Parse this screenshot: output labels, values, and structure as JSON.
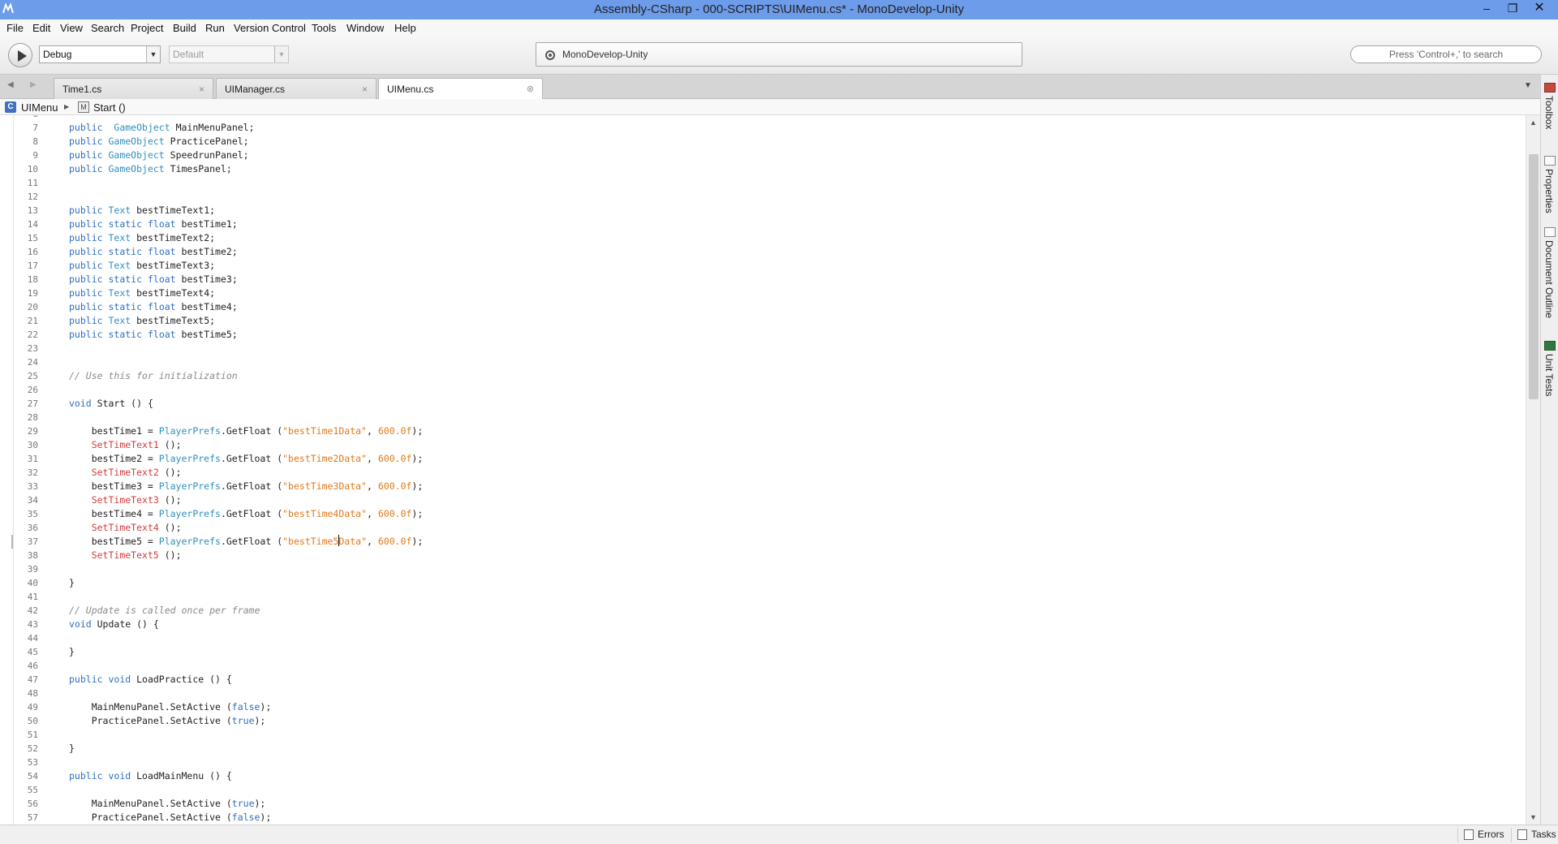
{
  "window": {
    "title": "Assembly-CSharp - 000-SCRIPTS\\UIMenu.cs* - MonoDevelop-Unity",
    "controls": {
      "minimize": "–",
      "maximize": "❐",
      "close": "✕"
    }
  },
  "menubar": {
    "items": [
      "File",
      "Edit",
      "View",
      "Search",
      "Project",
      "Build",
      "Run",
      "Version Control",
      "Tools",
      "Window",
      "Help"
    ]
  },
  "toolbar": {
    "configuration": "Debug",
    "target": "Default",
    "status_text": "MonoDevelop-Unity",
    "search_placeholder": "Press 'Control+,' to search"
  },
  "tabs": [
    {
      "label": "Time1.cs",
      "close": "×",
      "active": false
    },
    {
      "label": "UIManager.cs",
      "close": "×",
      "active": false
    },
    {
      "label": "UIMenu.cs",
      "close": "⊗",
      "active": true
    }
  ],
  "breadcrumb": {
    "class_icon": "C",
    "class_name": "UIMenu",
    "method_name": "Start ()"
  },
  "side_pads": [
    "Toolbox",
    "Properties",
    "Document Outline",
    "Unit Tests"
  ],
  "statusbar": {
    "errors_label": "Errors",
    "tasks_label": "Tasks"
  },
  "editor": {
    "current_line": 37,
    "lines": [
      {
        "n": "6",
        "tokens": []
      },
      {
        "n": "7",
        "tokens": [
          [
            "kw",
            "public"
          ],
          [
            "",
            "  "
          ],
          [
            "ty",
            "GameObject"
          ],
          [
            "",
            " MainMenuPanel;"
          ]
        ]
      },
      {
        "n": "8",
        "tokens": [
          [
            "kw",
            "public"
          ],
          [
            "",
            " "
          ],
          [
            "ty",
            "GameObject"
          ],
          [
            "",
            " PracticePanel;"
          ]
        ]
      },
      {
        "n": "9",
        "tokens": [
          [
            "kw",
            "public"
          ],
          [
            "",
            " "
          ],
          [
            "ty",
            "GameObject"
          ],
          [
            "",
            " SpeedrunPanel;"
          ]
        ]
      },
      {
        "n": "10",
        "tokens": [
          [
            "kw",
            "public"
          ],
          [
            "",
            " "
          ],
          [
            "ty",
            "GameObject"
          ],
          [
            "",
            " TimesPanel;"
          ]
        ]
      },
      {
        "n": "11",
        "tokens": []
      },
      {
        "n": "12",
        "tokens": []
      },
      {
        "n": "13",
        "tokens": [
          [
            "kw",
            "public"
          ],
          [
            "",
            " "
          ],
          [
            "ty",
            "Text"
          ],
          [
            "",
            " bestTimeText1;"
          ]
        ]
      },
      {
        "n": "14",
        "tokens": [
          [
            "kw",
            "public"
          ],
          [
            "",
            " "
          ],
          [
            "kw",
            "static"
          ],
          [
            "",
            " "
          ],
          [
            "kw",
            "float"
          ],
          [
            "",
            " bestTime1;"
          ]
        ]
      },
      {
        "n": "15",
        "tokens": [
          [
            "kw",
            "public"
          ],
          [
            "",
            " "
          ],
          [
            "ty",
            "Text"
          ],
          [
            "",
            " bestTimeText2;"
          ]
        ]
      },
      {
        "n": "16",
        "tokens": [
          [
            "kw",
            "public"
          ],
          [
            "",
            " "
          ],
          [
            "kw",
            "static"
          ],
          [
            "",
            " "
          ],
          [
            "kw",
            "float"
          ],
          [
            "",
            " bestTime2;"
          ]
        ]
      },
      {
        "n": "17",
        "tokens": [
          [
            "kw",
            "public"
          ],
          [
            "",
            " "
          ],
          [
            "ty",
            "Text"
          ],
          [
            "",
            " bestTimeText3;"
          ]
        ]
      },
      {
        "n": "18",
        "tokens": [
          [
            "kw",
            "public"
          ],
          [
            "",
            " "
          ],
          [
            "kw",
            "static"
          ],
          [
            "",
            " "
          ],
          [
            "kw",
            "float"
          ],
          [
            "",
            " bestTime3;"
          ]
        ]
      },
      {
        "n": "19",
        "tokens": [
          [
            "kw",
            "public"
          ],
          [
            "",
            " "
          ],
          [
            "ty",
            "Text"
          ],
          [
            "",
            " bestTimeText4;"
          ]
        ]
      },
      {
        "n": "20",
        "tokens": [
          [
            "kw",
            "public"
          ],
          [
            "",
            " "
          ],
          [
            "kw",
            "static"
          ],
          [
            "",
            " "
          ],
          [
            "kw",
            "float"
          ],
          [
            "",
            " bestTime4;"
          ]
        ]
      },
      {
        "n": "21",
        "tokens": [
          [
            "kw",
            "public"
          ],
          [
            "",
            " "
          ],
          [
            "ty",
            "Text"
          ],
          [
            "",
            " bestTimeText5;"
          ]
        ]
      },
      {
        "n": "22",
        "tokens": [
          [
            "kw",
            "public"
          ],
          [
            "",
            " "
          ],
          [
            "kw",
            "static"
          ],
          [
            "",
            " "
          ],
          [
            "kw",
            "float"
          ],
          [
            "",
            " bestTime5;"
          ]
        ]
      },
      {
        "n": "23",
        "tokens": []
      },
      {
        "n": "24",
        "tokens": []
      },
      {
        "n": "25",
        "tokens": [
          [
            "cm",
            "// Use this for initialization"
          ]
        ]
      },
      {
        "n": "26",
        "tokens": []
      },
      {
        "n": "27",
        "tokens": [
          [
            "kw",
            "void"
          ],
          [
            "",
            " Start () {"
          ]
        ]
      },
      {
        "n": "28",
        "tokens": []
      },
      {
        "n": "29",
        "tokens": [
          [
            "",
            "    bestTime1 = "
          ],
          [
            "ty",
            "PlayerPrefs"
          ],
          [
            "",
            ".GetFloat ("
          ],
          [
            "st",
            "\"bestTime1Data\""
          ],
          [
            "",
            ", "
          ],
          [
            "nu",
            "600.0f"
          ],
          [
            "",
            ");"
          ]
        ]
      },
      {
        "n": "30",
        "tokens": [
          [
            "",
            "    "
          ],
          [
            "mt",
            "SetTimeText1"
          ],
          [
            "",
            " ();"
          ]
        ]
      },
      {
        "n": "31",
        "tokens": [
          [
            "",
            "    bestTime2 = "
          ],
          [
            "ty",
            "PlayerPrefs"
          ],
          [
            "",
            ".GetFloat ("
          ],
          [
            "st",
            "\"bestTime2Data\""
          ],
          [
            "",
            ", "
          ],
          [
            "nu",
            "600.0f"
          ],
          [
            "",
            ");"
          ]
        ]
      },
      {
        "n": "32",
        "tokens": [
          [
            "",
            "    "
          ],
          [
            "mt",
            "SetTimeText2"
          ],
          [
            "",
            " ();"
          ]
        ]
      },
      {
        "n": "33",
        "tokens": [
          [
            "",
            "    bestTime3 = "
          ],
          [
            "ty",
            "PlayerPrefs"
          ],
          [
            "",
            ".GetFloat ("
          ],
          [
            "st",
            "\"bestTime3Data\""
          ],
          [
            "",
            ", "
          ],
          [
            "nu",
            "600.0f"
          ],
          [
            "",
            ");"
          ]
        ]
      },
      {
        "n": "34",
        "tokens": [
          [
            "",
            "    "
          ],
          [
            "mt",
            "SetTimeText3"
          ],
          [
            "",
            " ();"
          ]
        ]
      },
      {
        "n": "35",
        "tokens": [
          [
            "",
            "    bestTime4 = "
          ],
          [
            "ty",
            "PlayerPrefs"
          ],
          [
            "",
            ".GetFloat ("
          ],
          [
            "st",
            "\"bestTime4Data\""
          ],
          [
            "",
            ", "
          ],
          [
            "nu",
            "600.0f"
          ],
          [
            "",
            ");"
          ]
        ]
      },
      {
        "n": "36",
        "tokens": [
          [
            "",
            "    "
          ],
          [
            "mt",
            "SetTimeText4"
          ],
          [
            "",
            " ();"
          ]
        ]
      },
      {
        "n": "37",
        "tokens": [
          [
            "",
            "    bestTime5 = "
          ],
          [
            "ty",
            "PlayerPrefs"
          ],
          [
            "",
            ".GetFloat ("
          ],
          [
            "st",
            "\"bestTime5"
          ],
          [
            "caret",
            ""
          ],
          [
            "st",
            "Data\""
          ],
          [
            "",
            ", "
          ],
          [
            "nu",
            "600.0f"
          ],
          [
            "",
            ");"
          ]
        ]
      },
      {
        "n": "38",
        "tokens": [
          [
            "",
            "    "
          ],
          [
            "mt",
            "SetTimeText5"
          ],
          [
            "",
            " ();"
          ]
        ]
      },
      {
        "n": "39",
        "tokens": []
      },
      {
        "n": "40",
        "tokens": [
          [
            "",
            "}"
          ]
        ]
      },
      {
        "n": "41",
        "tokens": []
      },
      {
        "n": "42",
        "tokens": [
          [
            "cm",
            "// Update is called once per frame"
          ]
        ]
      },
      {
        "n": "43",
        "tokens": [
          [
            "kw",
            "void"
          ],
          [
            "",
            " Update () {"
          ]
        ]
      },
      {
        "n": "44",
        "tokens": []
      },
      {
        "n": "45",
        "tokens": [
          [
            "",
            "}"
          ]
        ]
      },
      {
        "n": "46",
        "tokens": []
      },
      {
        "n": "47",
        "tokens": [
          [
            "kw",
            "public"
          ],
          [
            "",
            " "
          ],
          [
            "kw",
            "void"
          ],
          [
            "",
            " LoadPractice () {"
          ]
        ]
      },
      {
        "n": "48",
        "tokens": []
      },
      {
        "n": "49",
        "tokens": [
          [
            "",
            "    MainMenuPanel.SetActive ("
          ],
          [
            "kw",
            "false"
          ],
          [
            "",
            ");"
          ]
        ]
      },
      {
        "n": "50",
        "tokens": [
          [
            "",
            "    PracticePanel.SetActive ("
          ],
          [
            "kw",
            "true"
          ],
          [
            "",
            ");"
          ]
        ]
      },
      {
        "n": "51",
        "tokens": []
      },
      {
        "n": "52",
        "tokens": [
          [
            "",
            "}"
          ]
        ]
      },
      {
        "n": "53",
        "tokens": []
      },
      {
        "n": "54",
        "tokens": [
          [
            "kw",
            "public"
          ],
          [
            "",
            " "
          ],
          [
            "kw",
            "void"
          ],
          [
            "",
            " LoadMainMenu () {"
          ]
        ]
      },
      {
        "n": "55",
        "tokens": []
      },
      {
        "n": "56",
        "tokens": [
          [
            "",
            "    MainMenuPanel.SetActive ("
          ],
          [
            "kw",
            "true"
          ],
          [
            "",
            ");"
          ]
        ]
      },
      {
        "n": "57",
        "tokens": [
          [
            "",
            "    PracticePanel.SetActive ("
          ],
          [
            "kw",
            "false"
          ],
          [
            "",
            ");"
          ]
        ]
      }
    ]
  }
}
